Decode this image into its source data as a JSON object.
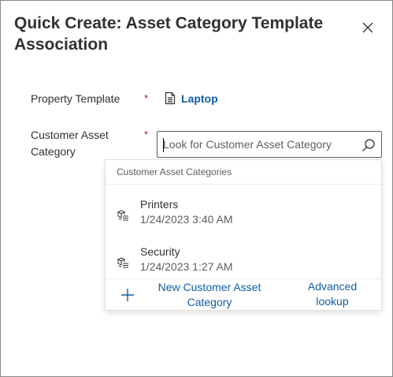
{
  "dialog": {
    "title": "Quick Create: Asset Category Template Association",
    "close_icon": "close-icon"
  },
  "fields": {
    "property_template": {
      "label": "Property Template",
      "required_marker": "*",
      "value": "Laptop",
      "icon": "document-icon"
    },
    "customer_asset_category": {
      "label_line1": "Customer Asset",
      "label_line2": "Category",
      "required_marker": "*",
      "placeholder": "Look for Customer Asset Category",
      "value": "",
      "search_icon": "search-icon"
    }
  },
  "dropdown": {
    "header": "Customer Asset Categories",
    "items": [
      {
        "name": "Printers",
        "date": "1/24/2023 3:40 AM",
        "icon": "asset-category-icon"
      },
      {
        "name": "Security",
        "date": "1/24/2023 1:27 AM",
        "icon": "asset-category-icon"
      }
    ],
    "footer": {
      "new_label": "New Customer Asset Category",
      "advanced_label": "Advanced lookup"
    }
  },
  "colors": {
    "link": "#115ea3",
    "required": "#a4262c",
    "text": "#323130",
    "secondary_text": "#605e5c"
  }
}
